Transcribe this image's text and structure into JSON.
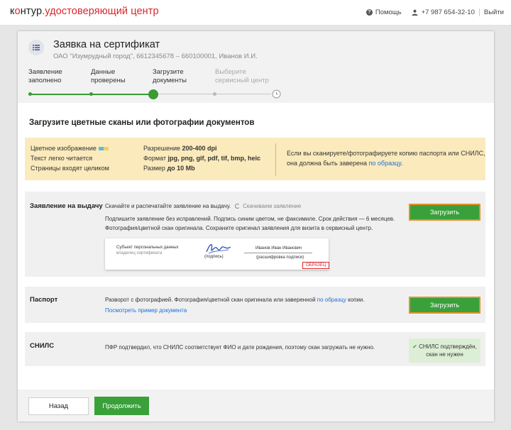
{
  "header": {
    "logo_main": "к",
    "logo_o": "о",
    "logo_rest": "нтур",
    "logo_product": ".удостоверяющий центр",
    "help": "Помощь",
    "phone": "+7 987 654-32-10",
    "logout": "Выйти"
  },
  "request": {
    "title": "Заявка на сертификат",
    "subtitle": "ОАО \"Изумрудный город\", 6612345678 – 660100001, Иванов И.И."
  },
  "steps": [
    {
      "line1": "Заявление",
      "line2": "заполнено",
      "state": "done"
    },
    {
      "line1": "Данные",
      "line2": "проверены",
      "state": "done"
    },
    {
      "line1": "Загрузите",
      "line2": "документы",
      "state": "current"
    },
    {
      "line1": "Выберите",
      "line2": "сервисный центр",
      "state": "upcoming"
    }
  ],
  "section_title": "Загрузите цветные сканы или фотографии документов",
  "requirements": {
    "left": [
      "Цветное изображение",
      "Текст легко читается",
      "Страницы входят целиком"
    ],
    "resolution_label": "Разрешение ",
    "resolution_value": "200-400 dpi",
    "format_label": "Формат ",
    "format_value": "jpg, png, gif, pdf, tif, bmp, heic",
    "size_label": "Размер ",
    "size_value": "до 10 Mb",
    "note_text": "Если вы сканируете/фотографируете копию паспорта или СНИЛС, она должна быть заверена ",
    "note_link": "по образцу",
    "note_end": "."
  },
  "documents": {
    "application": {
      "name": "Заявление на выдачу",
      "line1": "Скачайте и распечатайте заявление на выдачу.",
      "pending": "Скачиваем заявление",
      "line2": "Подпишите заявление без исправлений. Подпись синим цветом, не факсимиле. Срок действия — 6 месяцев.",
      "line3": "Фотография/цветной скан оригинала. Сохраните оригинал заявления для визита в сервисный центр.",
      "upload_label": "Загрузить",
      "sample": {
        "subject": "Субъект персональных данных",
        "owner": "владелец сертификата",
        "signature_label": "(подпись)",
        "person": "Иванов Иван Иванович",
        "decode_label": "(расшифровка подписи)",
        "stamp": "ОБРАЗЕЦ"
      }
    },
    "passport": {
      "name": "Паспорт",
      "text": "Разворот с фотографией. Фотография/цветной скан оригинала или заверенной ",
      "link": "по образцу",
      "text_end": " копии.",
      "example_link": "Посмотреть пример документа",
      "upload_label": "Загрузить"
    },
    "snils": {
      "name": "СНИЛС",
      "text": "ПФР подтвердил, что СНИЛС соответствует ФИО и дате рождения, поэтому скан загружать не нужно.",
      "status_line1": "СНИЛС подтверждён,",
      "status_line2": "скан не нужен"
    }
  },
  "footer": {
    "back_label": "Назад",
    "next_label": "Продолжить"
  },
  "colors": {
    "brand_red": "#d9262c",
    "accent_green": "#3aa03a",
    "highlight_orange": "#e8902a",
    "notice_yellow": "#fbeabc",
    "link_blue": "#1a6fd8"
  }
}
